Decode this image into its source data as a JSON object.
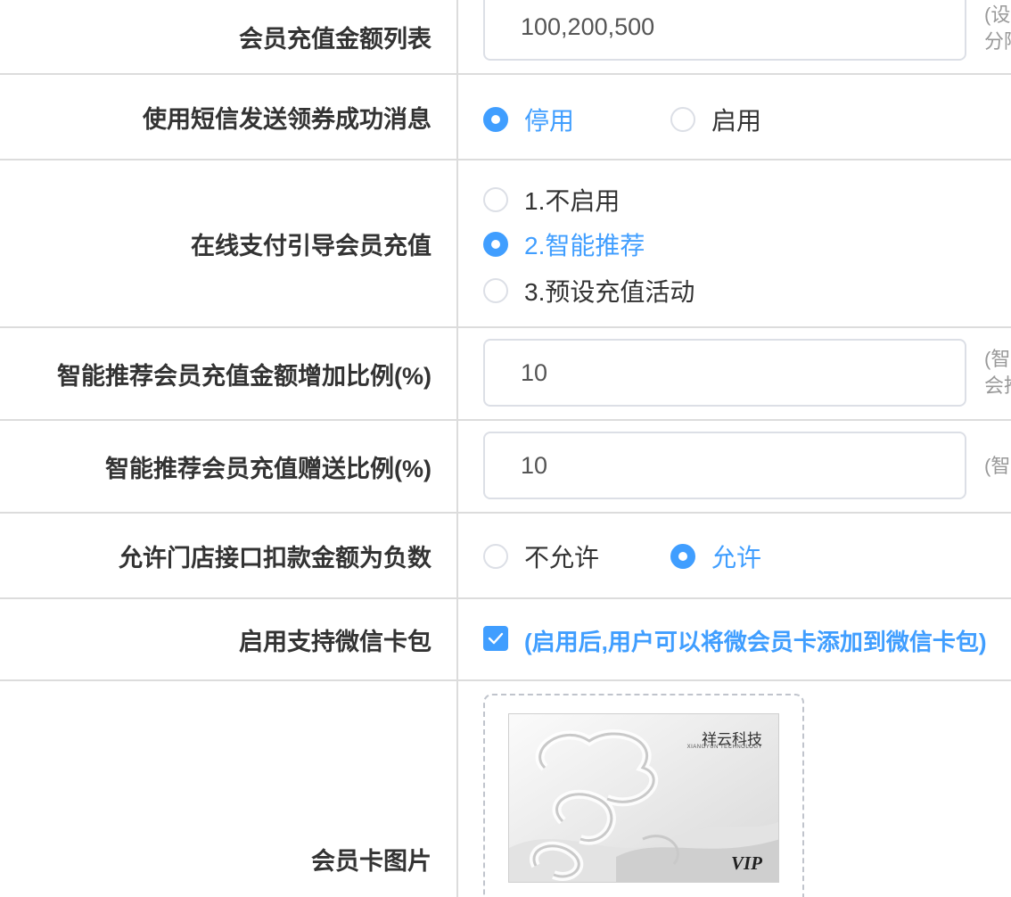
{
  "rows": {
    "recharge_amounts": {
      "label": "会员充值金额列表",
      "value": "100,200,500",
      "hint_line1": "(设",
      "hint_line2": "分隔"
    },
    "sms_coupon": {
      "label": "使用短信发送领券成功消息",
      "options": [
        "停用",
        "启用"
      ],
      "selected": "停用"
    },
    "online_pay_guide": {
      "label": "在线支付引导会员充值",
      "options": [
        "1.不启用",
        "2.智能推荐",
        "3.预设充值活动"
      ],
      "selected": "2.智能推荐"
    },
    "smart_increase_ratio": {
      "label": "智能推荐会员充值金额增加比例(%)",
      "value": "10",
      "hint_line1": "(智",
      "hint_line2": "会推"
    },
    "smart_bonus_ratio": {
      "label": "智能推荐会员充值赠送比例(%)",
      "value": "10",
      "hint_line1": "(智"
    },
    "negative_deduction": {
      "label": "允许门店接口扣款金额为负数",
      "options": [
        "不允许",
        "允许"
      ],
      "selected": "允许"
    },
    "wechat_card": {
      "label": "启用支持微信卡包",
      "checked": true,
      "text": "(启用后,用户可以将微会员卡添加到微信卡包)"
    },
    "card_image": {
      "label": "会员卡图片",
      "brand": "祥云科技",
      "brand_sub": "XIANGYUN TECHNOLOGY",
      "badge": "VIP"
    }
  },
  "colors": {
    "accent": "#409eff",
    "border": "#dcdcdc",
    "hint": "#999999"
  }
}
